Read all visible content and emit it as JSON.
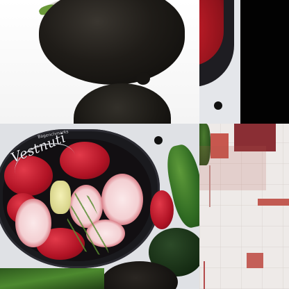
{
  "image": {
    "watermark": {
      "main": "Vestnuti",
      "sub": "Bagenchmarks"
    }
  },
  "colors": {
    "radish_red": "#b01224",
    "black_radish": "#1f1c18",
    "bowl": "#1a1a1e",
    "cucumber": "#2f6a22",
    "cloth_pattern": "#b44a4a"
  }
}
